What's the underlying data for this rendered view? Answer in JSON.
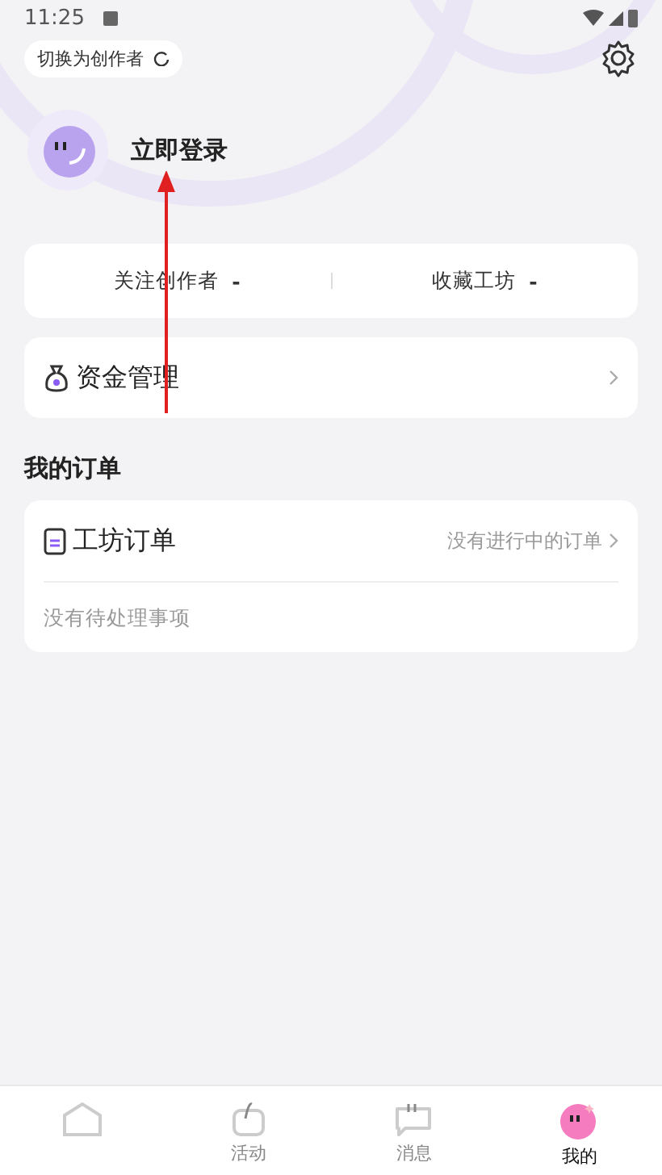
{
  "status_bar": {
    "time": "11:25"
  },
  "header": {
    "switch_label": "切换为创作者",
    "login_label": "立即登录"
  },
  "stats": [
    {
      "label": "关注创作者",
      "value": "-"
    },
    {
      "label": "收藏工坊",
      "value": "-"
    }
  ],
  "funds": {
    "label": "资金管理"
  },
  "orders": {
    "title": "我的订单",
    "label": "工坊订单",
    "status": "没有进行中的订单",
    "pending": "没有待处理事项"
  },
  "tabs": [
    {
      "kind": "home",
      "selected": false
    },
    {
      "kind": "activity",
      "label": "活动",
      "selected": false
    },
    {
      "kind": "message",
      "label": "消息",
      "selected": false
    },
    {
      "kind": "mine",
      "label": "我的",
      "selected": true
    }
  ]
}
